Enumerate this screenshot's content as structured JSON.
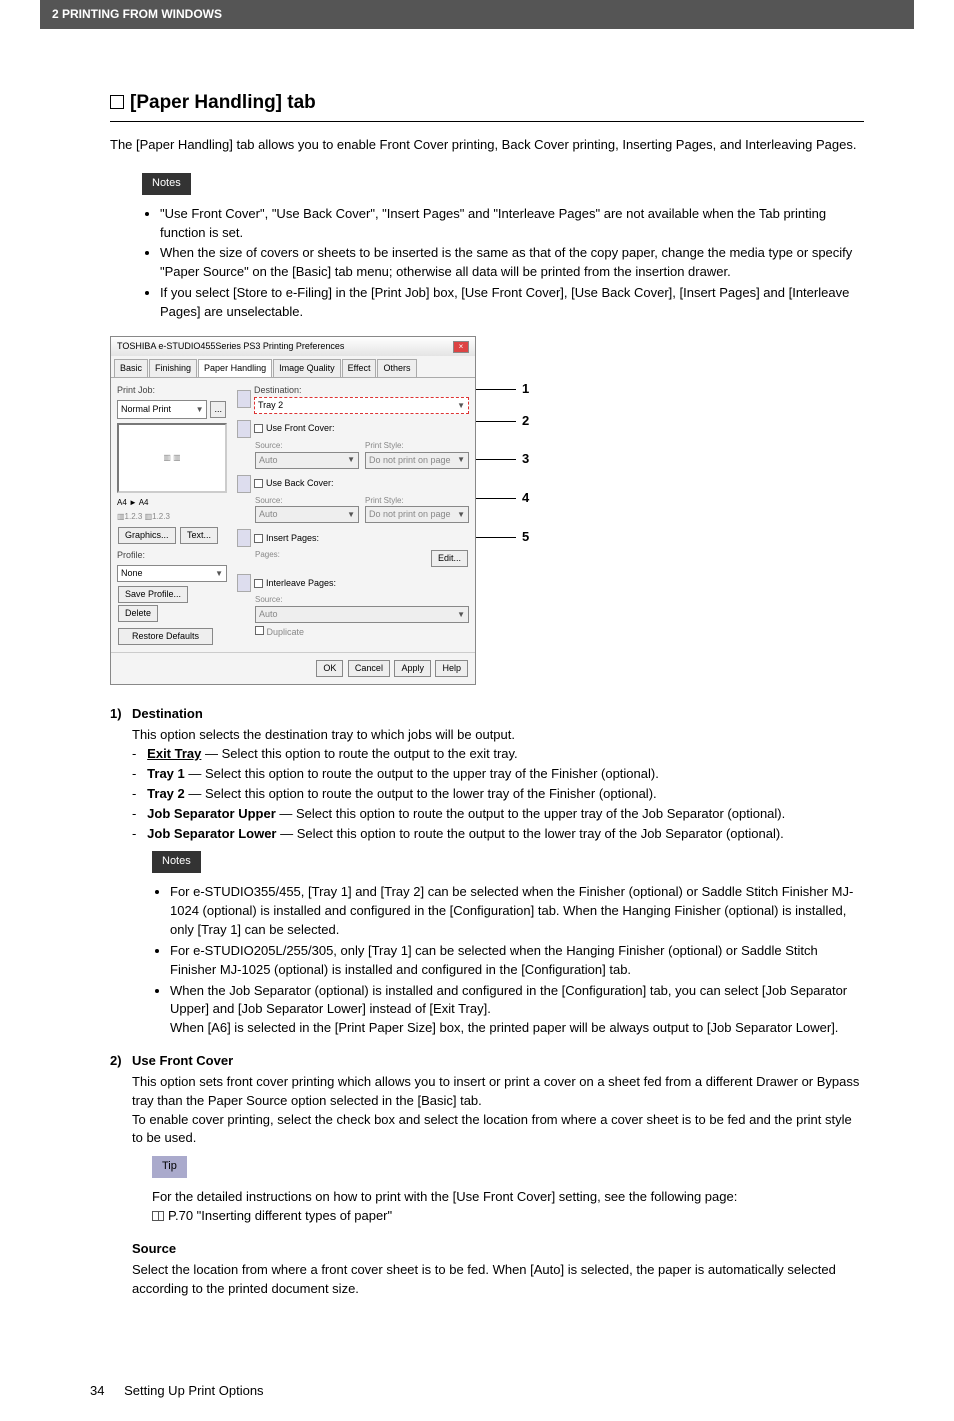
{
  "header": {
    "breadcrumb": "2 PRINTING FROM WINDOWS"
  },
  "section": {
    "title": "[Paper Handling] tab",
    "intro": "The [Paper Handling] tab allows you to enable Front Cover printing, Back Cover printing, Inserting Pages, and Interleaving Pages."
  },
  "notes1": {
    "label": "Notes",
    "items": [
      "\"Use Front Cover\", \"Use Back Cover\", \"Insert Pages\" and \"Interleave Pages\" are not available when the Tab printing function is set.",
      "When the size of covers or sheets to be inserted is the same as that of the copy paper, change the media type or specify \"Paper Source\" on the [Basic] tab menu; otherwise all data will be printed from the insertion drawer.",
      "If you select [Store to e-Filing] in the [Print Job] box, [Use Front Cover], [Use Back Cover], [Insert Pages] and [Interleave Pages] are unselectable."
    ]
  },
  "dialog": {
    "title": "TOSHIBA e-STUDIO455Series PS3 Printing Preferences",
    "tabs": [
      "Basic",
      "Finishing",
      "Paper Handling",
      "Image Quality",
      "Effect",
      "Others"
    ],
    "printjob_label": "Print Job:",
    "printjob_value": "Normal Print",
    "paper_info": "A4        ► A4",
    "mini_buttons": {
      "graphics": "Graphics...",
      "text": "Text..."
    },
    "profile_label": "Profile:",
    "profile_value": "None",
    "save_profile": "Save Profile...",
    "delete": "Delete",
    "restore": "Restore Defaults",
    "destination_label": "Destination:",
    "destination_value": "Tray 2",
    "groups": {
      "front": {
        "title": "Use Front Cover:",
        "source_label": "Source:",
        "source_value": "Auto",
        "style_label": "Print Style:",
        "style_value": "Do not print on page"
      },
      "back": {
        "title": "Use Back Cover:",
        "source_label": "Source:",
        "source_value": "Auto",
        "style_label": "Print Style:",
        "style_value": "Do not print on page"
      },
      "insert": {
        "title": "Insert Pages:",
        "pages_label": "Pages:",
        "edit": "Edit..."
      },
      "inter": {
        "title": "Interleave Pages:",
        "source_label": "Source:",
        "source_value": "Auto",
        "duplicate": "Duplicate"
      }
    },
    "buttons": {
      "ok": "OK",
      "cancel": "Cancel",
      "apply": "Apply",
      "help": "Help"
    }
  },
  "callouts": {
    "c1": "1",
    "c2": "2",
    "c3": "3",
    "c4": "4",
    "c5": "5"
  },
  "defs": {
    "d1": {
      "num": "1)",
      "title": "Destination",
      "desc": "This option selects the destination tray to which jobs will be output.",
      "options": [
        {
          "name": "Exit Tray",
          "text": " — Select this option to route the output to the exit tray."
        },
        {
          "name": "Tray 1",
          "text": " — Select this option to route the output to the upper tray of the Finisher (optional)."
        },
        {
          "name": "Tray 2",
          "text": " — Select this option to route the output to the lower tray of the Finisher (optional)."
        },
        {
          "name": "Job Separator Upper",
          "text": " — Select this option to route the output to the upper tray of the Job Separator (optional)."
        },
        {
          "name": "Job Separator Lower",
          "text": " — Select this option to route the output to the lower tray of the Job Separator (optional)."
        }
      ],
      "notes": {
        "label": "Notes",
        "items": [
          "For e-STUDIO355/455, [Tray 1] and [Tray 2] can be selected when the Finisher (optional) or Saddle Stitch Finisher MJ-1024 (optional) is installed and configured in the [Configuration] tab. When the Hanging Finisher (optional) is installed, only [Tray 1] can be selected.",
          "For e-STUDIO205L/255/305, only [Tray 1] can be selected when the Hanging Finisher (optional) or Saddle Stitch Finisher MJ-1025 (optional) is installed and configured in the [Configuration] tab.",
          "When the Job Separator (optional) is installed and configured in the [Configuration] tab, you can select [Job Separator Upper] and [Job Separator Lower] instead of [Exit Tray].\nWhen [A6] is selected in the [Print Paper Size] box, the printed paper will be always output to [Job Separator Lower]."
        ]
      }
    },
    "d2": {
      "num": "2)",
      "title": "Use Front Cover",
      "desc1": "This option sets front cover printing which allows you to insert or print a cover on a sheet fed from a different Drawer or Bypass tray than the Paper Source option selected in the [Basic] tab.",
      "desc2": "To enable cover printing, select the check box and select the location from where a cover sheet is to be fed and the print style to be used.",
      "tip": {
        "label": "Tip",
        "line1": "For the detailed instructions on how to print with the [Use Front Cover] setting, see the following page:",
        "ref": "P.70 \"Inserting different types of paper\""
      }
    },
    "source": {
      "title": "Source",
      "desc": "Select the location from where a front cover sheet is to be fed. When [Auto] is selected, the paper is automatically selected according to the printed document size."
    }
  },
  "footer": {
    "page": "34",
    "section": "Setting Up Print Options"
  }
}
